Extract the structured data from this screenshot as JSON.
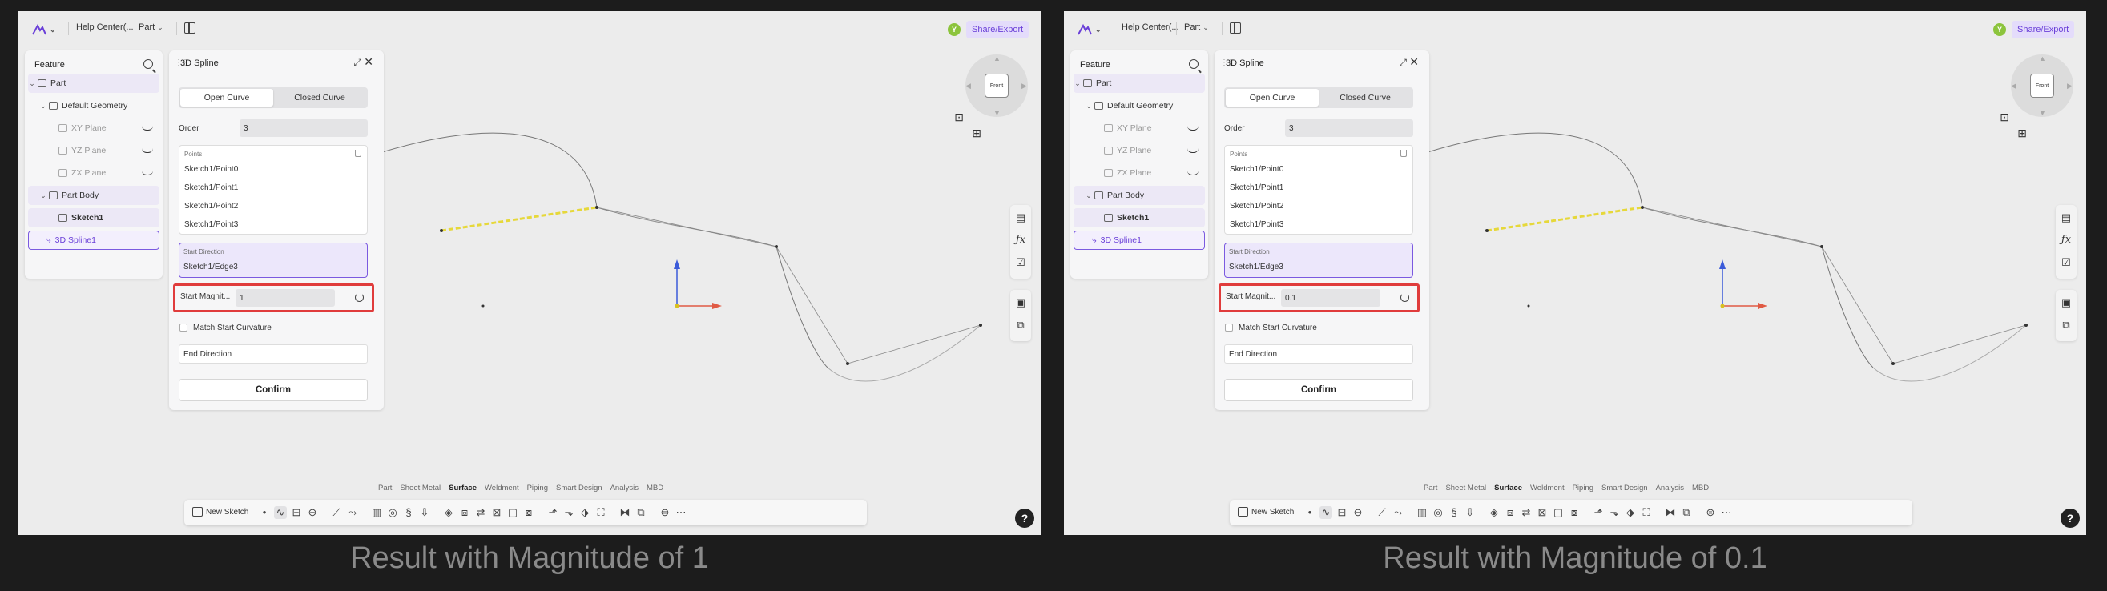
{
  "panels": [
    {
      "caption": "Result with Magnitude of 1",
      "header": {
        "breadcrumb_help": "Help Center(...",
        "breadcrumb_part": "Part",
        "avatar_letter": "Y",
        "share_label": "Share/Export"
      },
      "feature_tree": {
        "title": "Feature",
        "items": [
          "Part",
          "Default Geometry",
          "XY Plane",
          "YZ Plane",
          "ZX Plane",
          "Part Body",
          "Sketch1",
          "3D Spline1"
        ]
      },
      "spline_panel": {
        "title": "3D Spline",
        "modes": [
          "Open Curve",
          "Closed Curve"
        ],
        "order_label": "Order",
        "order_value": "3",
        "points_header": "Points",
        "points": [
          "Sketch1/Point0",
          "Sketch1/Point1",
          "Sketch1/Point2",
          "Sketch1/Point3"
        ],
        "start_direction_label": "Start Direction",
        "start_direction_value": "Sketch1/Edge3",
        "start_magnitude_label": "Start Magnit...",
        "start_magnitude_value": "1",
        "match_curvature_label": "Match Start Curvature",
        "end_direction_label": "End Direction",
        "confirm_label": "Confirm"
      },
      "nav_cube_face": "Front",
      "workbench_tabs": [
        "Part",
        "Sheet Metal",
        "Surface",
        "Weldment",
        "Piping",
        "Smart Design",
        "Analysis",
        "MBD"
      ],
      "active_tab": "Surface",
      "toolbar": {
        "new_sketch_label": "New Sketch"
      },
      "help_label": "?"
    },
    {
      "caption": "Result with Magnitude of 0.1",
      "header": {
        "breadcrumb_help": "Help Center(...",
        "breadcrumb_part": "Part",
        "avatar_letter": "Y",
        "share_label": "Share/Export"
      },
      "feature_tree": {
        "title": "Feature",
        "items": [
          "Part",
          "Default Geometry",
          "XY Plane",
          "YZ Plane",
          "ZX Plane",
          "Part Body",
          "Sketch1",
          "3D Spline1"
        ]
      },
      "spline_panel": {
        "title": "3D Spline",
        "modes": [
          "Open Curve",
          "Closed Curve"
        ],
        "order_label": "Order",
        "order_value": "3",
        "points_header": "Points",
        "points": [
          "Sketch1/Point0",
          "Sketch1/Point1",
          "Sketch1/Point2",
          "Sketch1/Point3"
        ],
        "start_direction_label": "Start Direction",
        "start_direction_value": "Sketch1/Edge3",
        "start_magnitude_label": "Start Magnit...",
        "start_magnitude_value": "0.1",
        "match_curvature_label": "Match Start Curvature",
        "end_direction_label": "End Direction",
        "confirm_label": "Confirm"
      },
      "nav_cube_face": "Front",
      "workbench_tabs": [
        "Part",
        "Sheet Metal",
        "Surface",
        "Weldment",
        "Piping",
        "Smart Design",
        "Analysis",
        "MBD"
      ],
      "active_tab": "Surface",
      "toolbar": {
        "new_sketch_label": "New Sketch"
      },
      "help_label": "?"
    }
  ],
  "colors": {
    "accent": "#6a3fd8",
    "highlight_border": "#e03c3c",
    "selected_edge": "#e6d83a",
    "axis_blue": "#3b5bd9",
    "axis_red": "#e05a44"
  }
}
